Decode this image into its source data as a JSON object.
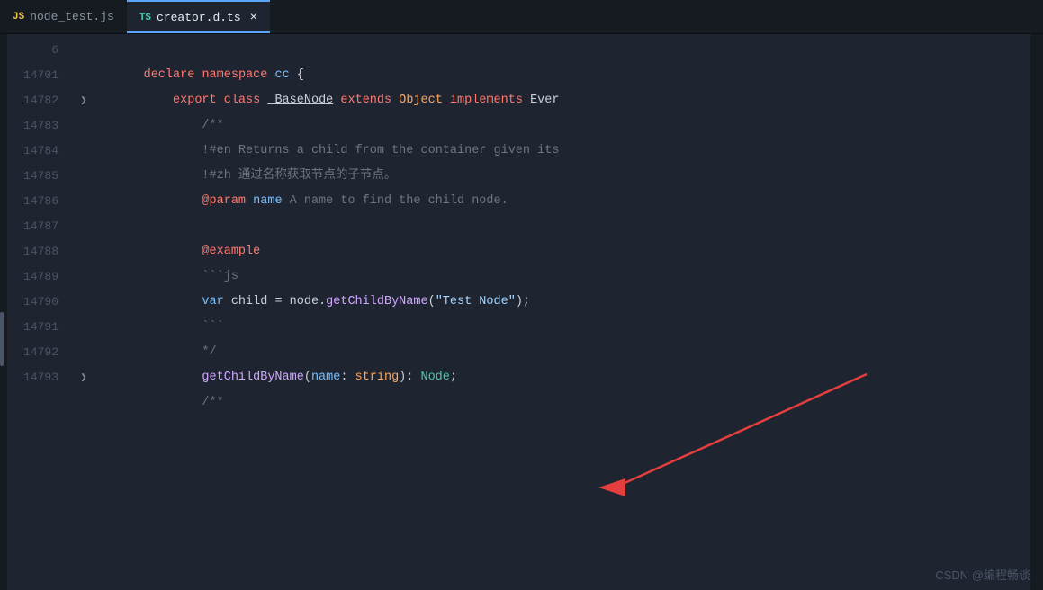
{
  "tabs": [
    {
      "id": "node-test",
      "icon": "JS",
      "icon_color": "js",
      "label": "node_test.js",
      "active": false,
      "closeable": false
    },
    {
      "id": "creator-d-ts",
      "icon": "TS",
      "icon_color": "ts",
      "label": "creator.d.ts",
      "active": true,
      "closeable": true
    }
  ],
  "lines": [
    {
      "num": "6",
      "fold": false,
      "code": "declare_namespace"
    },
    {
      "num": "14701",
      "fold": false,
      "code": "export_class"
    },
    {
      "num": "14782",
      "fold": true,
      "code": "block_comment_start"
    },
    {
      "num": "14783",
      "fold": false,
      "code": "comment_en"
    },
    {
      "num": "14784",
      "fold": false,
      "code": "comment_zh"
    },
    {
      "num": "14785",
      "fold": false,
      "code": "comment_param"
    },
    {
      "num": "14786",
      "fold": false,
      "code": "blank"
    },
    {
      "num": "14787",
      "fold": false,
      "code": "comment_example"
    },
    {
      "num": "14788",
      "fold": false,
      "code": "comment_js_start"
    },
    {
      "num": "14789",
      "fold": false,
      "code": "comment_js_code"
    },
    {
      "num": "14790",
      "fold": false,
      "code": "comment_js_end"
    },
    {
      "num": "14791",
      "fold": false,
      "code": "comment_close"
    },
    {
      "num": "14792",
      "fold": false,
      "code": "method_sig"
    },
    {
      "num": "14793",
      "fold": true,
      "code": "block_comment_start2"
    }
  ],
  "watermark": "CSDN @编程畅谈"
}
